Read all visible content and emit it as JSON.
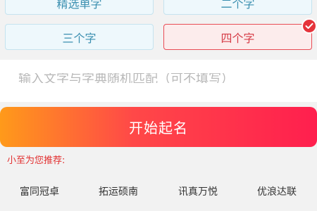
{
  "options": {
    "jingxuan": "精选单字",
    "two": "二个字",
    "three": "三个字",
    "four": "四个字"
  },
  "input": {
    "placeholder": "输入文字与字典随机匹配（可不填写）"
  },
  "start_button": {
    "label": "开始起名"
  },
  "recommend": {
    "label": "小至为您推荐:",
    "names": [
      "富同冠卓",
      "拓运硕南",
      "讯真万悦",
      "优浪达联"
    ]
  },
  "colors": {
    "accent_red": "#e5343b",
    "option_blue_text": "#3b8fb0",
    "button_gradient_start": "#ff9a1a",
    "button_gradient_end": "#ff1f4e"
  }
}
